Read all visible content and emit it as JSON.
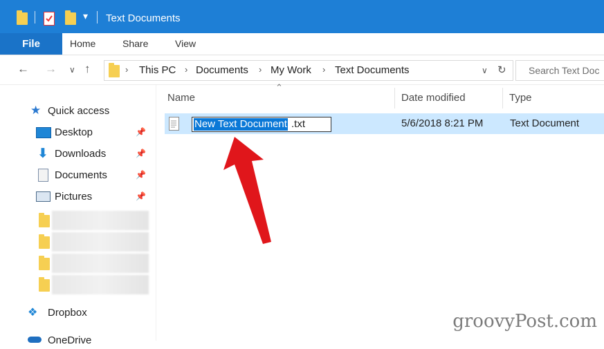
{
  "window": {
    "title": "Text Documents"
  },
  "ribbon": {
    "tabs": [
      "File",
      "Home",
      "Share",
      "View"
    ]
  },
  "address": {
    "crumbs": [
      "This PC",
      "Documents",
      "My Work",
      "Text Documents"
    ],
    "search_placeholder": "Search Text Doc"
  },
  "sidebar": {
    "quick_access": "Quick access",
    "items": [
      "Desktop",
      "Downloads",
      "Documents",
      "Pictures"
    ],
    "dropbox": "Dropbox",
    "onedrive": "OneDrive"
  },
  "list": {
    "columns": [
      "Name",
      "Date modified",
      "Type"
    ],
    "rows": [
      {
        "name_selected": "New Text Document",
        "ext": ".txt",
        "date": "5/6/2018 8:21 PM",
        "type": "Text Document"
      }
    ]
  },
  "watermark": "groovyPost.com",
  "colors": {
    "titlebar": "#1e7fd6",
    "selection": "#cce8ff",
    "arrow": "#e0161b"
  },
  "icons": [
    "folder-icon",
    "checklist-icon",
    "dropdown-icon",
    "back-arrow-icon",
    "forward-arrow-icon",
    "up-arrow-icon",
    "refresh-icon",
    "star-icon",
    "desktop-icon",
    "download-icon",
    "document-icon",
    "pictures-icon",
    "pin-icon",
    "dropbox-icon",
    "onedrive-icon",
    "text-file-icon",
    "red-arrow-annotation"
  ]
}
